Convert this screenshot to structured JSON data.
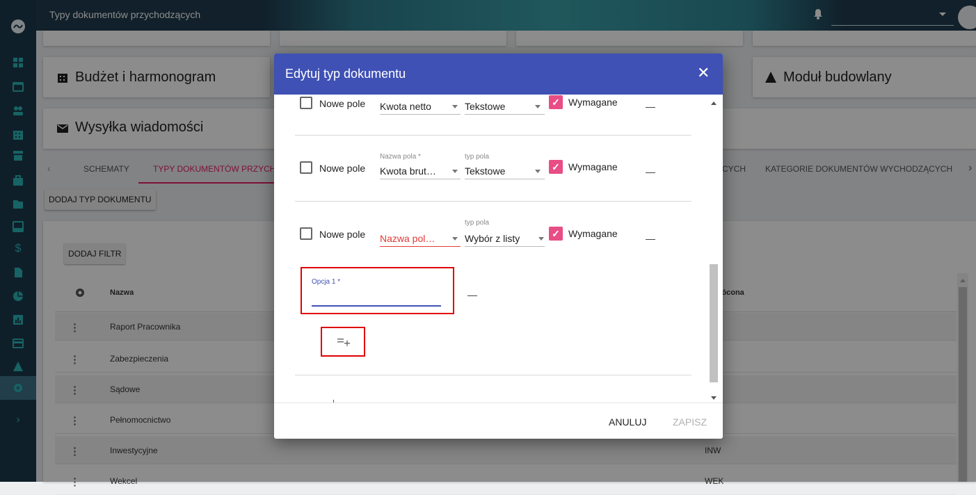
{
  "app": {
    "title": "Typy dokumentów przychodzących"
  },
  "cards": {
    "budget": "Budżet i harmonogram",
    "building": "Moduł budowlany",
    "messaging": "Wysyłka wiadomości"
  },
  "tabs": {
    "schematy": "SCHEMATY",
    "typy": "TYPY DOKUMENTÓW PRZYCH",
    "partial": "CYCH",
    "kategorie": "KATEGORIE DOKUMENTÓW WYCHODZĄCYCH"
  },
  "buttons": {
    "add_type": "DODAJ TYP DOKUMENTU",
    "add_filter": "DODAJ FILTR"
  },
  "table": {
    "col_name": "Nazwa",
    "col_abbr": "krócona",
    "rows": [
      {
        "name": "Raport Pracownika",
        "abbr": ""
      },
      {
        "name": "Zabezpieczenia",
        "abbr": ""
      },
      {
        "name": "Sądowe",
        "abbr": ""
      },
      {
        "name": "Pełnomocnictwo",
        "abbr": ""
      },
      {
        "name": "Inwestycyjne",
        "abbr": "INW"
      },
      {
        "name": "Wekcel",
        "abbr": "WEK"
      }
    ]
  },
  "dialog": {
    "title": "Edytuj typ dokumentu",
    "rows": [
      {
        "checkbox_label": "Nowe pole",
        "name_label": "",
        "name_value": "Kwota netto",
        "type_label": "",
        "type_value": "Tekstowe",
        "required_label": "Wymagane"
      },
      {
        "checkbox_label": "Nowe pole",
        "name_label": "Nazwa pola *",
        "name_value": "Kwota brut…",
        "type_label": "typ pola",
        "type_value": "Tekstowe",
        "required_label": "Wymagane"
      },
      {
        "checkbox_label": "Nowe pole",
        "name_label": "",
        "name_value": "Nazwa pol…",
        "type_label": "typ pola",
        "type_value": "Wybór z listy",
        "required_label": "Wymagane"
      }
    ],
    "option_label": "Opcja 1 *",
    "option_value": "",
    "cancel": "ANULUJ",
    "save": "ZAPISZ"
  },
  "colors": {
    "sidebar": "#1d3a4c",
    "accent_teal": "#2bb5b8",
    "dialog_header": "#3f51b5",
    "checkbox_pink": "#e94d85",
    "error_red": "#e53935",
    "tab_underline": "#e91e63"
  },
  "icons": [
    "logo-icon",
    "dashboard-icon",
    "calendar-icon",
    "users-icon",
    "building-icon",
    "store-icon",
    "briefcase-icon",
    "folder-icon",
    "inbox-icon",
    "dollar-icon",
    "file-icon",
    "pie-chart-icon",
    "bar-chart-icon",
    "card-icon",
    "warning-icon",
    "settings-icon",
    "chevron-right-icon",
    "bell-icon",
    "close-icon",
    "add-list-icon"
  ]
}
